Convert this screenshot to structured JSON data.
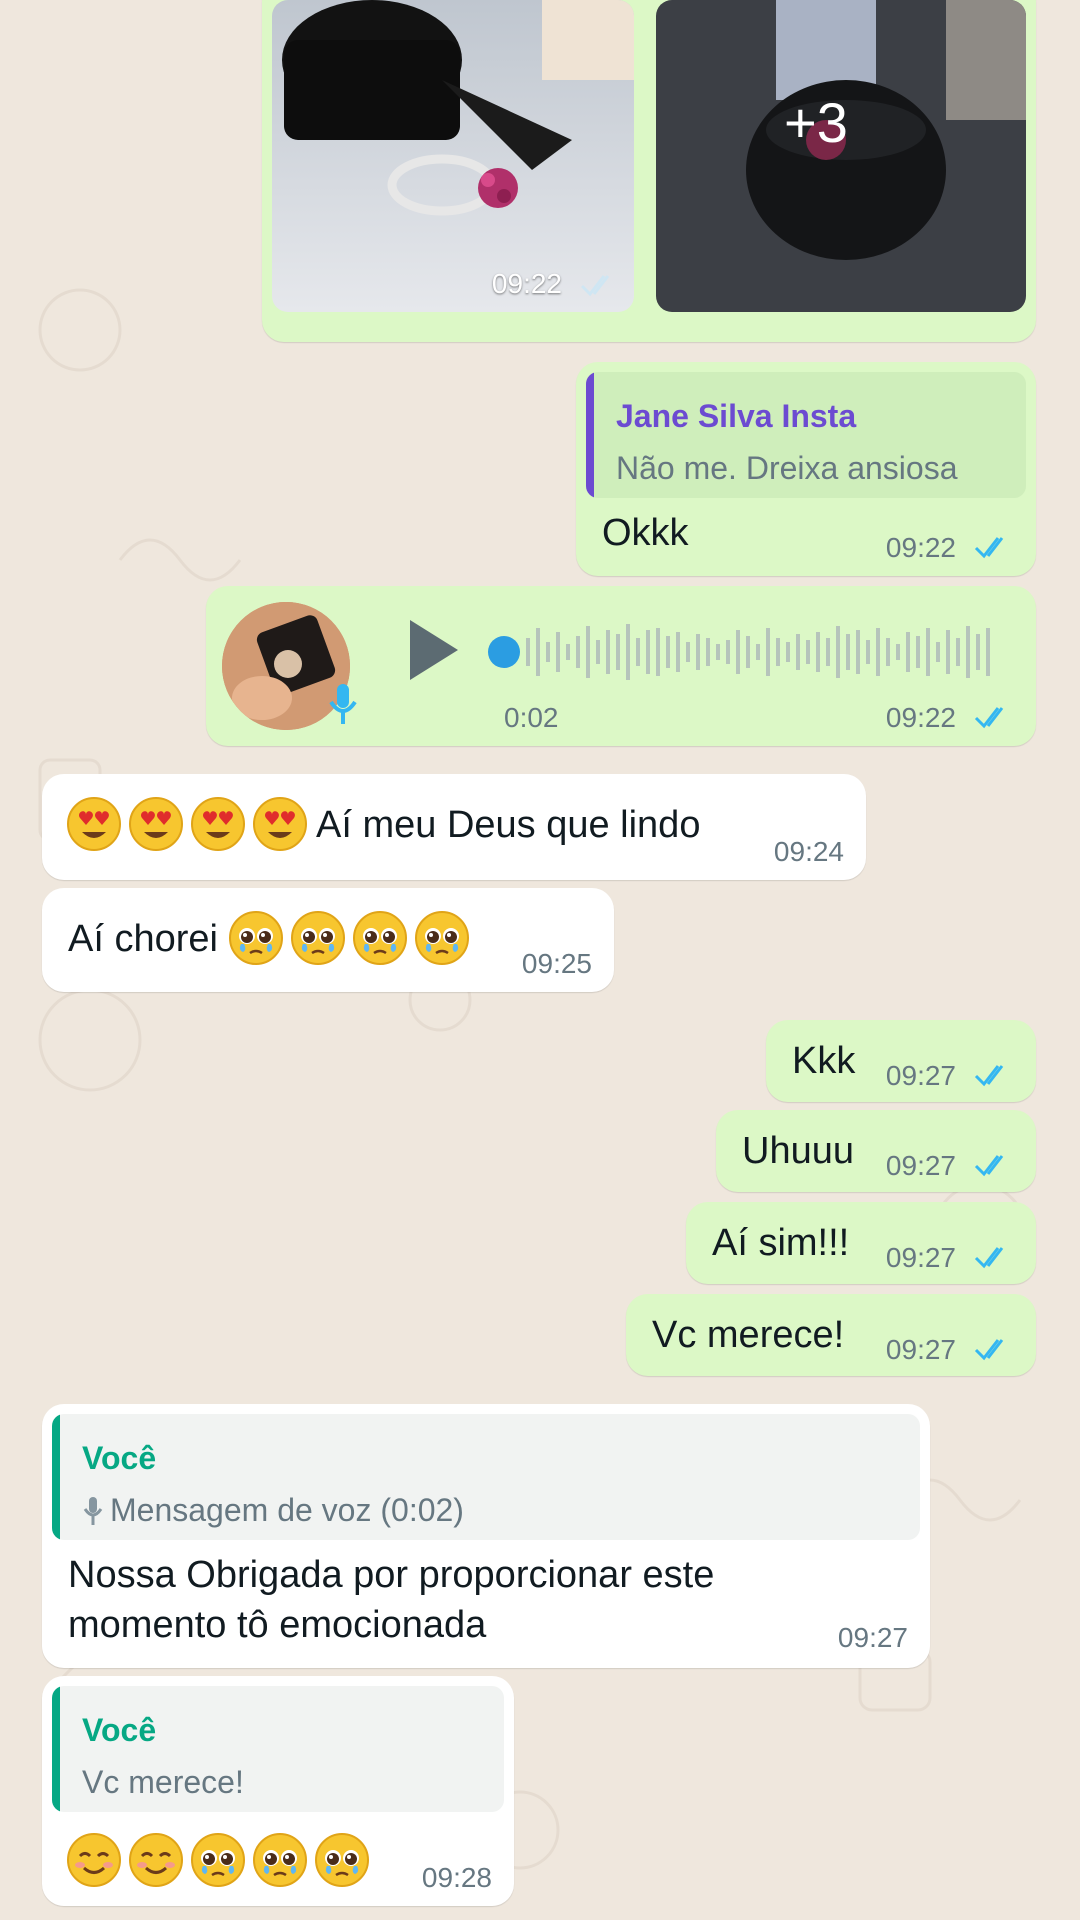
{
  "colors": {
    "outgoing_bubble": "#dcf8c6",
    "incoming_bubble": "#ffffff",
    "read_ticks": "#34b7f1",
    "quote_author_purple": "#6c4bd1",
    "quote_author_teal": "#06a884",
    "wallpaper": "#efe7dd"
  },
  "photo_album": {
    "time": "09:22",
    "more_count": "+3"
  },
  "reply_okkk": {
    "quote_author": "Jane Silva Insta",
    "quote_text": "Não me. Dreixa ansiosa",
    "text": "Okkk",
    "time": "09:22"
  },
  "voice_message": {
    "duration": "0:02",
    "time": "09:22",
    "play_icon": "play-icon",
    "mic_icon": "mic-icon"
  },
  "messages": {
    "lindo": {
      "emojis": [
        "heart-eyes-emoji",
        "heart-eyes-emoji",
        "heart-eyes-emoji",
        "heart-eyes-emoji"
      ],
      "text": "Aí meu Deus que lindo",
      "time": "09:24"
    },
    "chorei": {
      "text": "Aí chorei",
      "emojis": [
        "pleading-emoji",
        "pleading-emoji",
        "pleading-emoji",
        "pleading-emoji"
      ],
      "time": "09:25"
    },
    "kkk": {
      "text": "Kkk",
      "time": "09:27"
    },
    "uhuuu": {
      "text": "Uhuuu",
      "time": "09:27"
    },
    "ai_sim": {
      "text": "Aí sim!!!",
      "time": "09:27"
    },
    "vc_merece": {
      "text": "Vc merece!",
      "time": "09:27"
    }
  },
  "reply_obrigada": {
    "quote_author": "Você",
    "quote_text": "Mensagem de voz (0:02)",
    "text_line1": "Nossa Obrigada por proporcionar este",
    "text_line2": "momento tô emocionada",
    "time": "09:27"
  },
  "reply_emoji": {
    "quote_author": "Você",
    "quote_text": "Vc merece!",
    "emojis": [
      "smiling-emoji",
      "smiling-emoji",
      "pleading-emoji",
      "pleading-emoji",
      "pleading-emoji"
    ],
    "time": "09:28"
  }
}
